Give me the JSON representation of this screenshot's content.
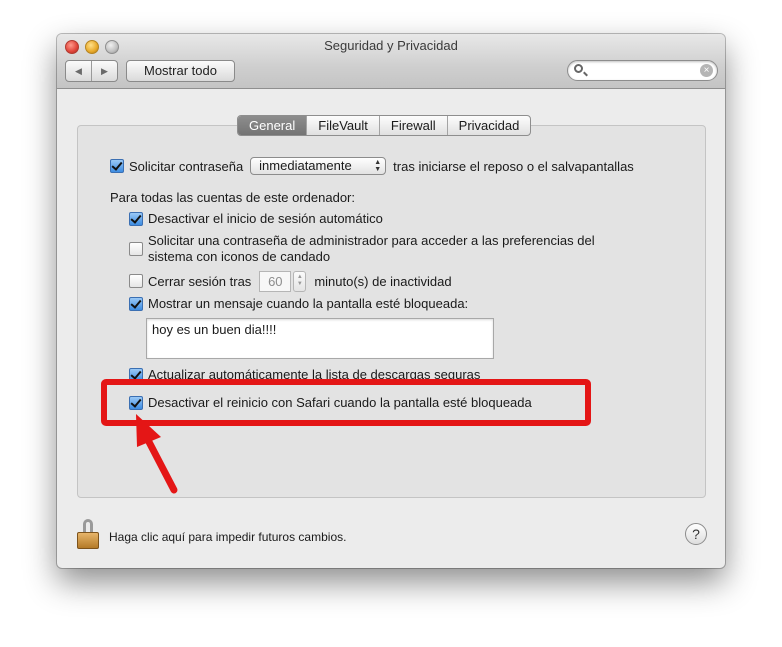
{
  "window": {
    "title": "Seguridad y Privacidad"
  },
  "toolbar": {
    "back_icon": "◀",
    "forward_icon": "▶",
    "show_all_label": "Mostrar todo",
    "search_placeholder": "",
    "search_clear_icon": "×"
  },
  "tabs": [
    {
      "label": "General",
      "active": true
    },
    {
      "label": "FileVault",
      "active": false
    },
    {
      "label": "Firewall",
      "active": false
    },
    {
      "label": "Privacidad",
      "active": false
    }
  ],
  "general": {
    "require_password": {
      "checked": true,
      "label": "Solicitar contraseña",
      "popup_value": "inmediatamente",
      "suffix": "tras iniciarse el reposo o el salvapantallas"
    },
    "all_accounts_label": "Para todas las cuentas de este ordenador:",
    "disable_autologin": {
      "checked": true,
      "label": "Desactivar el inicio de sesión automático"
    },
    "admin_password": {
      "checked": false,
      "label_line1": "Solicitar una contraseña de administrador para acceder a las preferencias del",
      "label_line2": "sistema con iconos de candado"
    },
    "logout_after": {
      "checked": false,
      "label": "Cerrar sesión tras",
      "value": "60",
      "suffix": "minuto(s) de inactividad"
    },
    "show_message": {
      "checked": true,
      "label": "Mostrar un mensaje cuando la pantalla esté bloqueada:",
      "message": "hoy es un buen dia!!!!"
    },
    "auto_update_downloads": {
      "checked": true,
      "label": "Actualizar automáticamente la lista de descargas seguras"
    },
    "disable_safari_restart": {
      "checked": true,
      "label": "Desactivar el reinicio con Safari cuando la pantalla esté bloqueada"
    }
  },
  "footer": {
    "lock_text": "Haga clic aquí para impedir futuros cambios.",
    "help_label": "?"
  },
  "annotation": {
    "color": "#e41616"
  }
}
